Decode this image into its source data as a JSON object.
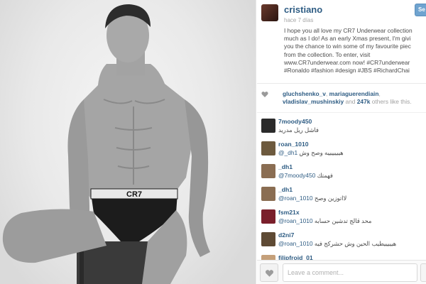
{
  "post": {
    "username": "cristiano",
    "time_ago": "hace 7 días",
    "follow_label": "Se",
    "caption_lines": [
      "I hope you all love my CR7 Underwear collection",
      "much as I do! As an early Xmas present, I'm givi",
      "you the chance to win some of my favourite piec",
      "from the collection. To enter, visit",
      "www.CR7underwear.com now! #CR7underwear",
      "#Ronaldo #fashion #design #JBS #RichardChai"
    ],
    "underwear_band_text": "CR7"
  },
  "likes": {
    "users_line1_a": "gluchshenko_v",
    "users_line1_sep": ",",
    "users_line1_b": "mariaguerendiain",
    "users_line1_end": ",",
    "users_line2_a": "vladislav_mushinskiy",
    "users_line2_mid": " and ",
    "count": "247k",
    "users_line2_end": " others like this."
  },
  "comments": [
    {
      "user": "7moody450",
      "mention": "",
      "text": "فاشل ريل مدريد",
      "avatar_color": "#2b2b2b"
    },
    {
      "user": "roan_1010",
      "mention": "@_dh1",
      "text": "هيييييييه وصح وش",
      "avatar_color": "#6d5a3e"
    },
    {
      "user": "_dh1",
      "mention": "@7moody450",
      "text": "فهمتك",
      "avatar_color": "#8a6d52"
    },
    {
      "user": "_dh1",
      "mention": "@roan_1010",
      "text": "لااتوزين وصح",
      "avatar_color": "#8a6d52"
    },
    {
      "user": "fsm21x",
      "mention": "@roan_1010",
      "text": "محد قالج تدشين حسابه",
      "avatar_color": "#7a1f2b"
    },
    {
      "user": "d2ni7",
      "mention": "@roan_1010",
      "text": "هيييييطيب الحين وش حشركج فيه",
      "avatar_color": "#5e4a34"
    },
    {
      "user": "filipfrojd_01",
      "mention": "",
      "text": "",
      "avatar_color": "#c5a07a"
    }
  ],
  "footer": {
    "comment_placeholder": "Leave a comment..."
  },
  "colors": {
    "link": "#2f5d84",
    "follow_button": "#6fa3cf"
  }
}
